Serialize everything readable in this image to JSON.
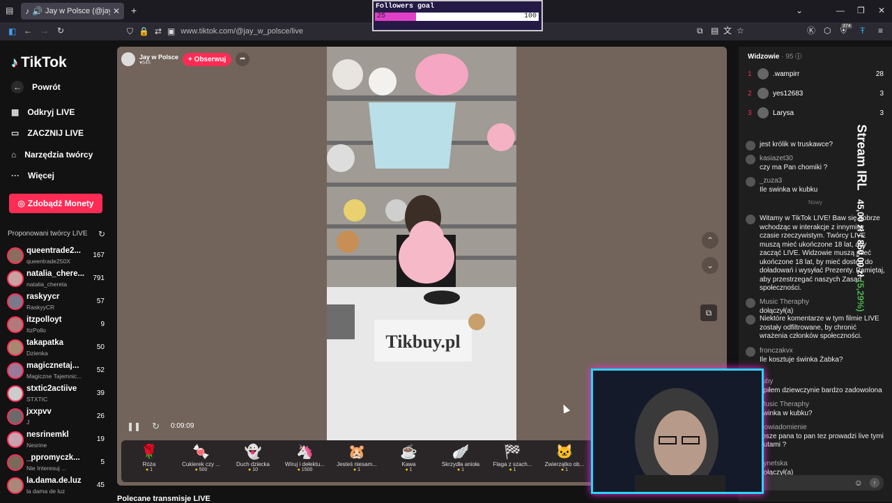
{
  "browser": {
    "tab_title": "Jay w Polsce (@jay_w_polsce)",
    "url": "www.tiktok.com/@jay_w_polsce/live",
    "notif_badge": "374"
  },
  "sidebar": {
    "logo": "TikTok",
    "back": "Powrót",
    "nav": [
      "Odkryj LIVE",
      "ZACZNIJ LIVE",
      "Narzędzia twórcy",
      "Więcej"
    ],
    "monety": "Zdobądź Monety",
    "suggested_title": "Proponowani twórcy LIVE",
    "creators": [
      {
        "name": "queentrade2...",
        "sub": "queentrade250X",
        "count": "167"
      },
      {
        "name": "natalia_chere...",
        "sub": "natalia_chereta",
        "count": "791"
      },
      {
        "name": "raskyycr",
        "sub": "RaskyyCR",
        "count": "57"
      },
      {
        "name": "itzpolloyt",
        "sub": "ItzPollo",
        "count": "9"
      },
      {
        "name": "takapatka",
        "sub": "Dzienka",
        "count": "50"
      },
      {
        "name": "magicznetaj...",
        "sub": "Magiczne Tajemnic...",
        "count": "52"
      },
      {
        "name": "stxtic2actiive",
        "sub": "STXTIC",
        "count": "39"
      },
      {
        "name": "jxxpvv",
        "sub": "J",
        "count": "26"
      },
      {
        "name": "nesrinemkl",
        "sub": "Nesrine",
        "count": "19"
      },
      {
        "name": "_ppromyczk...",
        "sub": "Nie Interesuj ...",
        "count": "5"
      },
      {
        "name": "la.dama.de.luz",
        "sub": "la dama de luz",
        "count": "45"
      }
    ]
  },
  "player": {
    "host": "Jay w Polsce",
    "host_likes": "545",
    "follow": "+ Obserwuj",
    "time": "0:09:09",
    "sign_text": "Tikbuy.pl",
    "gifts": [
      {
        "name": "Róża",
        "price": "1",
        "icon": "🌹"
      },
      {
        "name": "Cukierek czy ...",
        "price": "500",
        "icon": "🍬"
      },
      {
        "name": "Duch dziecka",
        "price": "10",
        "icon": "👻"
      },
      {
        "name": "Wiruj i dełektu...",
        "price": "1500",
        "icon": "🦄"
      },
      {
        "name": "Jesteś niesam...",
        "price": "1",
        "icon": "🐹"
      },
      {
        "name": "Kawa",
        "price": "1",
        "icon": "☕"
      },
      {
        "name": "Skrzydła anioła",
        "price": "1",
        "icon": "🪽"
      },
      {
        "name": "Flaga z szach...",
        "price": "1",
        "icon": "🏁"
      },
      {
        "name": "Zwierzątko ob...",
        "price": "1",
        "icon": "🐱"
      }
    ],
    "recommended": "Polecane transmisje LIVE"
  },
  "viewers": {
    "title": "Widzowie",
    "count": "95",
    "top": [
      {
        "rank": "1",
        "name": ".wampirr",
        "score": "28"
      },
      {
        "rank": "2",
        "name": "yes12683",
        "score": "3"
      },
      {
        "rank": "3",
        "name": "Larysa",
        "score": "3"
      }
    ]
  },
  "chat": [
    {
      "user": "",
      "text": "jest królik w truskawce?"
    },
    {
      "user": "kasiazet30",
      "text": "czy ma Pan chomiki ?"
    },
    {
      "user": "_zuza3",
      "text": "Ile swinka w kubku"
    },
    {
      "user": "",
      "text": "Nowy"
    },
    {
      "user": "",
      "text": "Witamy w TikTok LIVE! Baw się dobrze wchodząc w interakcje z innymi w czasie rzeczywistym. Twórcy LIVE muszą mieć ukończone 18 lat, aby zacząć LIVE. Widzowie muszą mieć ukończone 18 lat, by mieć dostęp do doładowań i wysyłać Prezenty. Pamiętaj, aby przestrzegać naszych Zasad społeczności."
    },
    {
      "user": "Music Theraphy",
      "text": "dołączył(a)"
    },
    {
      "user": "",
      "text": "Niektóre komentarze w tym filmie LIVE zostały odfiltrowane, by chronić wrażenia członków społeczności."
    },
    {
      "user": "fronczakvx",
      "text": "Ile kosztuje świnka Żabka?"
    },
    {
      "user": "ruby",
      "text": "upiłem dziewczynie bardzo zadowolona"
    },
    {
      "user": "Music Theraphy",
      "text": "swinka w kubku?"
    },
    {
      "user": "Powiadomienie",
      "text": "rosze pana to pan tez prowadzi live tymi butami ?"
    },
    {
      "user": "dynetska",
      "text": "dołączył(a)"
    }
  ],
  "overlay": {
    "goal_label": "Followers goal",
    "goal_current": "25",
    "goal_target": "100",
    "goal_fraction": 0.25,
    "irl_title": "Stream IRL",
    "irl_amount": "45,00 zł",
    "irl_goal": "850,00 zł",
    "irl_percent": "(5,29%)"
  }
}
